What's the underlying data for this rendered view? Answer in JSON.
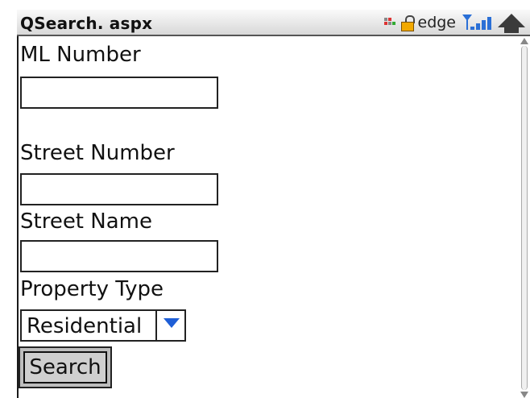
{
  "window": {
    "title": "QSearch. aspx"
  },
  "status_bar": {
    "carrier": "edge",
    "icons": [
      "network-activity-icon",
      "lock-icon",
      "signal-strength-icon",
      "up-arrow-icon"
    ]
  },
  "form": {
    "ml_number": {
      "label": "ML Number",
      "value": ""
    },
    "street_number": {
      "label": "Street Number",
      "value": ""
    },
    "street_name": {
      "label": "Street Name",
      "value": ""
    },
    "property_type": {
      "label": "Property Type",
      "selected": "Residential"
    },
    "search_button": {
      "label": "Search"
    }
  },
  "colors": {
    "accent": "#1e5ed6",
    "signal": "#2a6fd6",
    "lock": "#f2a900"
  }
}
